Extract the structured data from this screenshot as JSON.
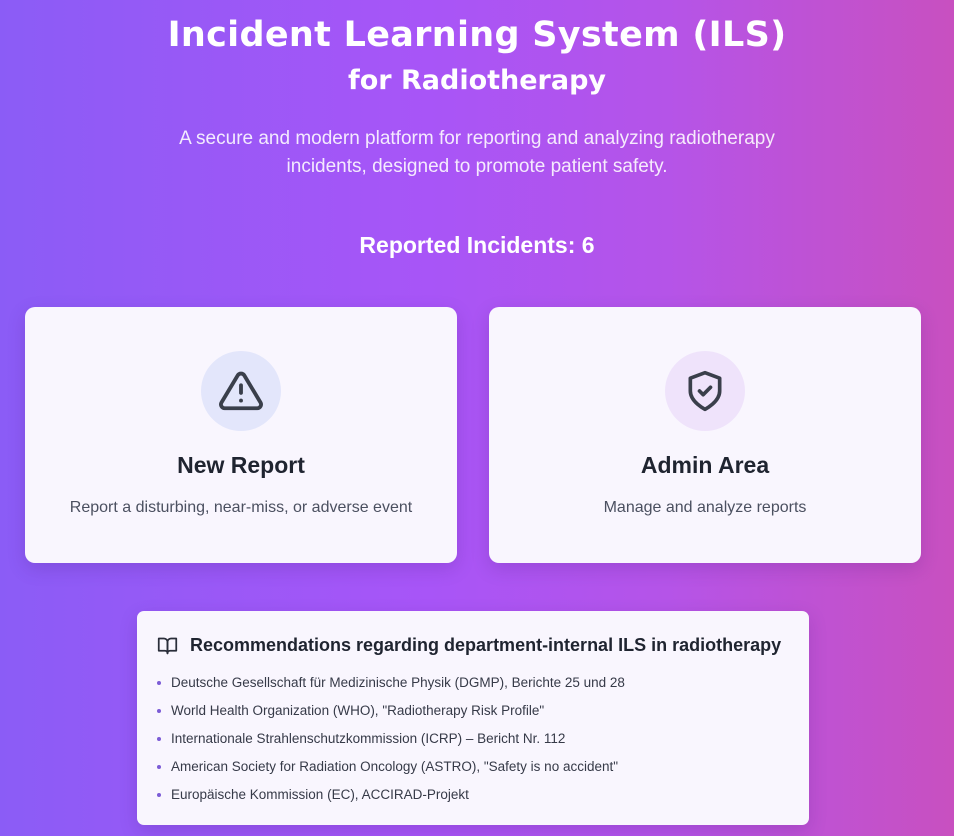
{
  "hero": {
    "title": "Incident Learning System (ILS)",
    "subtitle_title": "for Radiotherapy",
    "description": "A secure and modern platform for reporting and analyzing radiotherapy incidents, designed to promote patient safety."
  },
  "stats": {
    "reported_incidents": "Reported Incidents: 6"
  },
  "cards": {
    "new_report": {
      "icon": "warning-triangle-icon",
      "title": "New Report",
      "description": "Report a disturbing, near-miss, or adverse event"
    },
    "admin": {
      "icon": "shield-check-icon",
      "title": "Admin Area",
      "description": "Manage and analyze reports"
    }
  },
  "recommendations": {
    "icon": "book-open-icon",
    "title": "Recommendations regarding department-internal ILS in radiotherapy",
    "items": [
      "Deutsche Gesellschaft für Medizinische Physik (DGMP), Berichte 25 und 28",
      "World Health Organization (WHO), \"Radiotherapy Risk Profile\"",
      "Internationale Strahlenschutzkommission (ICRP) – Bericht Nr. 112",
      "American Society for Radiation Oncology (ASTRO), \"Safety is no accident\"",
      "Europäische Kommission (EC), ACCIRAD-Projekt"
    ]
  },
  "colors": {
    "background_start": "#8b5cf6",
    "background_end": "#c850c0",
    "card_background": "#f9f6fe",
    "icon_blue_bg": "#e3e6fb",
    "icon_purple_bg": "#efe3fb",
    "icon_stroke": "#3a3f4b",
    "bullet": "#7c5cd6"
  }
}
